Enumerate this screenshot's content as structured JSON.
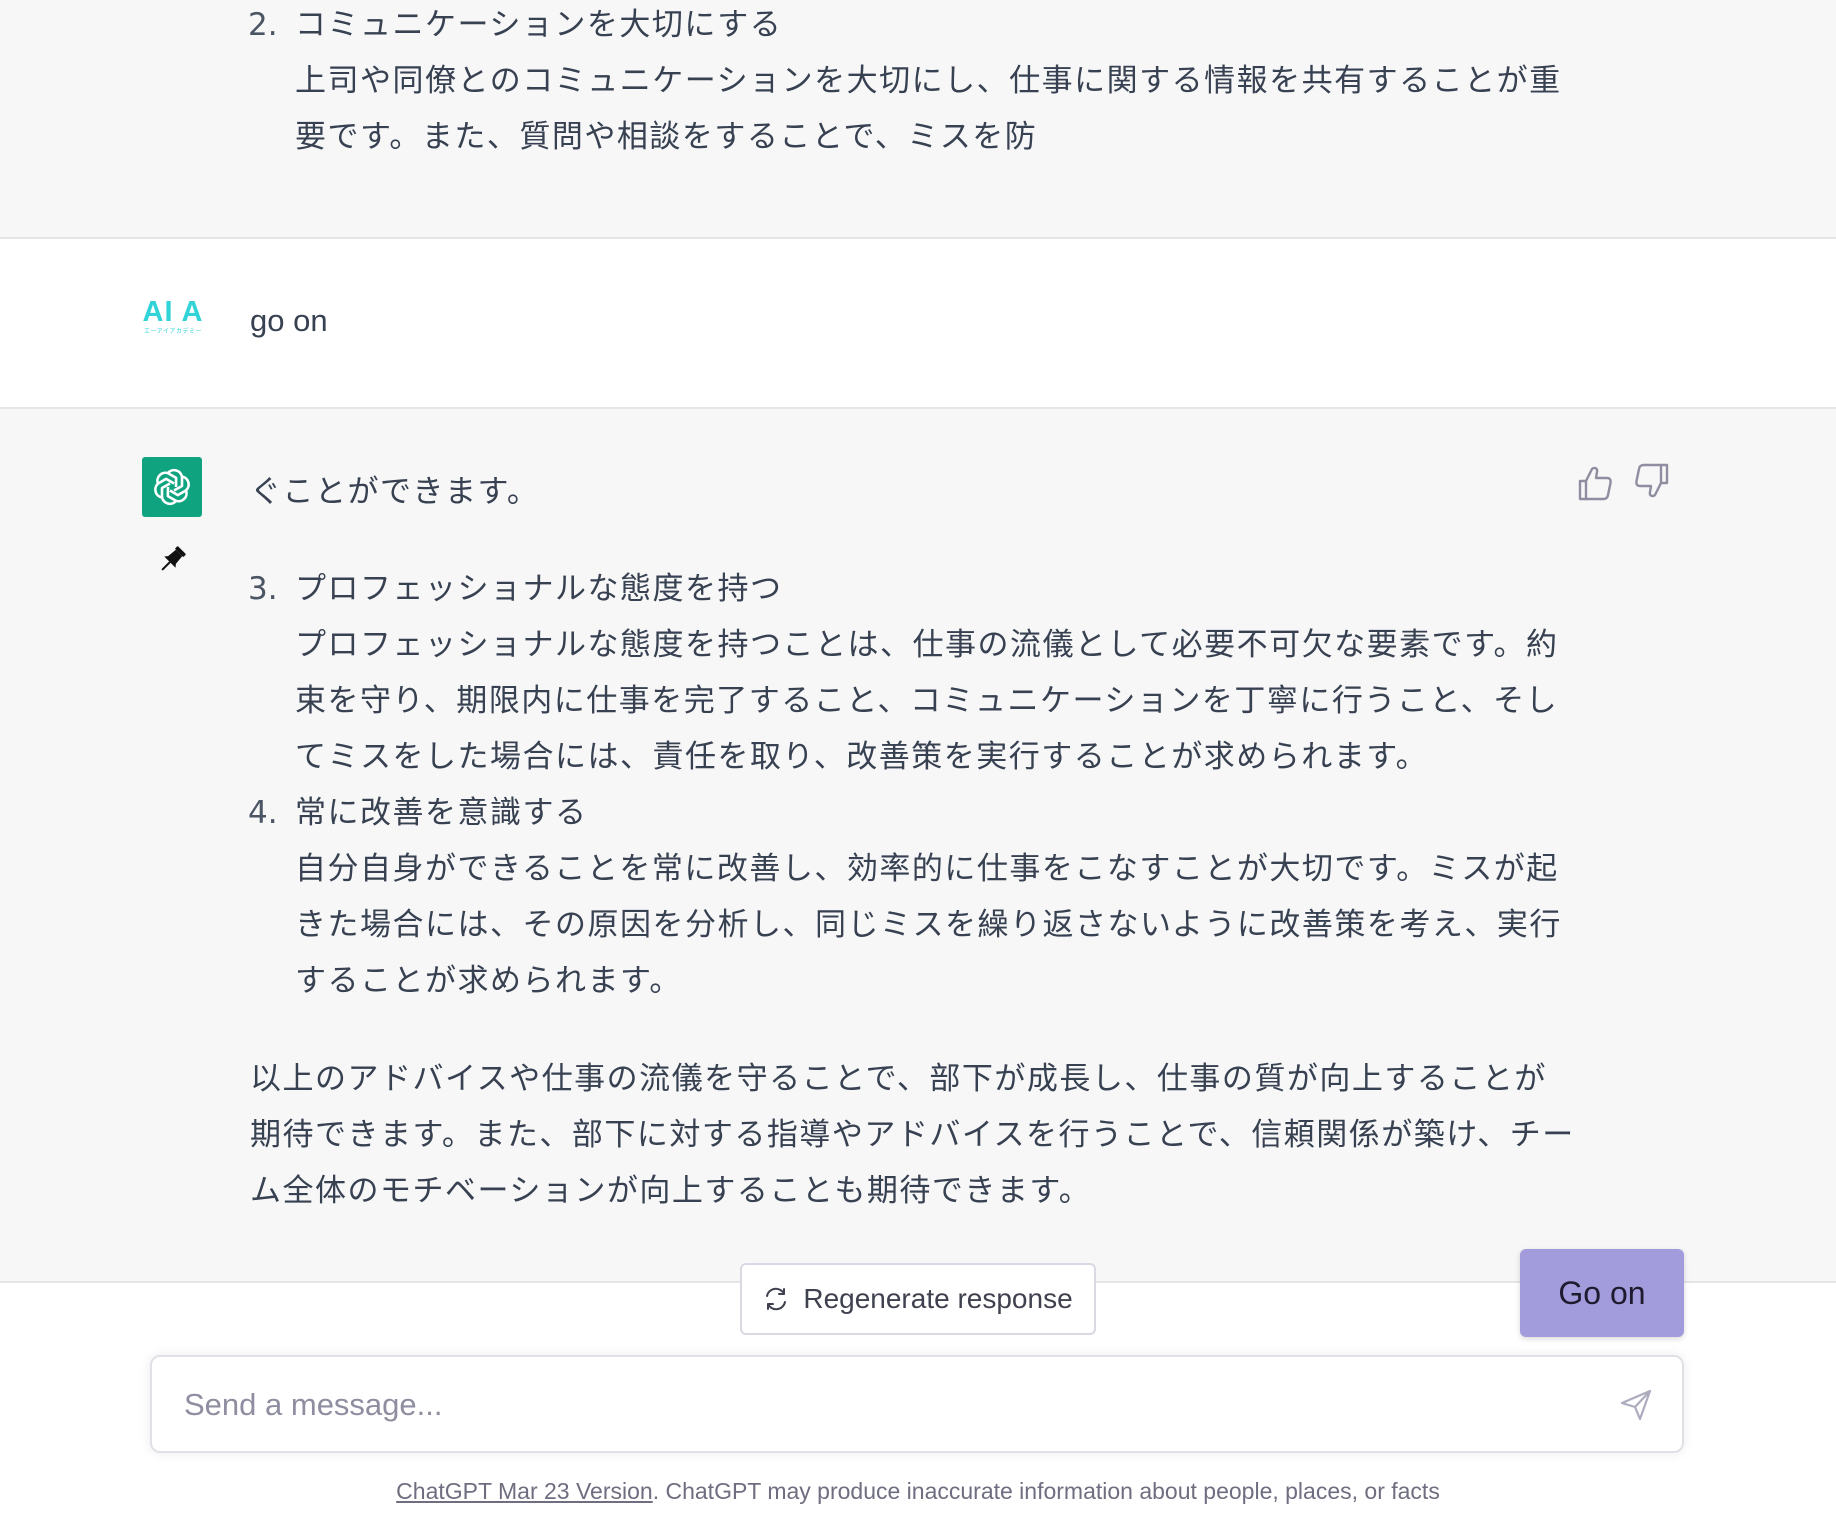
{
  "top_message": {
    "item2": {
      "number": "2.",
      "title": "コミュニケーションを大切にする",
      "lines": [
        "上司や同僚とのコミュニケーションを大切にし、仕事に関する情報を共有することが重",
        "要です。また、質問や相談をすることで、ミスを防"
      ]
    }
  },
  "user_message": {
    "avatar_text": "AI A",
    "avatar_subtext": "エーアイアカデミー",
    "text": "go on"
  },
  "assistant_message": {
    "intro": "ぐことができます。",
    "item3": {
      "number": "3.",
      "title": "プロフェッショナルな態度を持つ",
      "lines": [
        "プロフェッショナルな態度を持つことは、仕事の流儀として必要不可欠な要素です。約",
        "束を守り、期限内に仕事を完了すること、コミュニケーションを丁寧に行うこと、そし",
        "てミスをした場合には、責任を取り、改善策を実行することが求められます。"
      ]
    },
    "item4": {
      "number": "4.",
      "title": "常に改善を意識する",
      "lines": [
        "自分自身ができることを常に改善し、効率的に仕事をこなすことが大切です。ミスが起",
        "きた場合には、その原因を分析し、同じミスを繰り返さないように改善策を考え、実行",
        "することが求められます。"
      ]
    },
    "closing_lines": [
      "以上のアドバイスや仕事の流儀を守ることで、部下が成長し、仕事の質が向上することが",
      "期待できます。また、部下に対する指導やアドバイスを行うことで、信頼関係が築け、チー",
      "ム全体のモチベーションが向上することも期待できます。"
    ]
  },
  "icons": {
    "assistant_avatar": "openai-logo-icon",
    "pin": "pin-icon",
    "thumbs_up": "thumbs-up-icon",
    "thumbs_down": "thumbs-down-icon",
    "regenerate": "refresh-icon",
    "send": "send-icon"
  },
  "colors": {
    "assistant_avatar_bg": "#10a37f",
    "user_logo": "#2fd3d8",
    "go_on_button": "#a29bdc",
    "section_gray": "#f7f7f8"
  },
  "controls": {
    "regenerate_label": "Regenerate response",
    "go_on_label": "Go on",
    "message_placeholder": "Send a message..."
  },
  "footer": {
    "link_text": "ChatGPT Mar 23 Version",
    "text": ". ChatGPT may produce inaccurate information about people, places, or facts"
  }
}
